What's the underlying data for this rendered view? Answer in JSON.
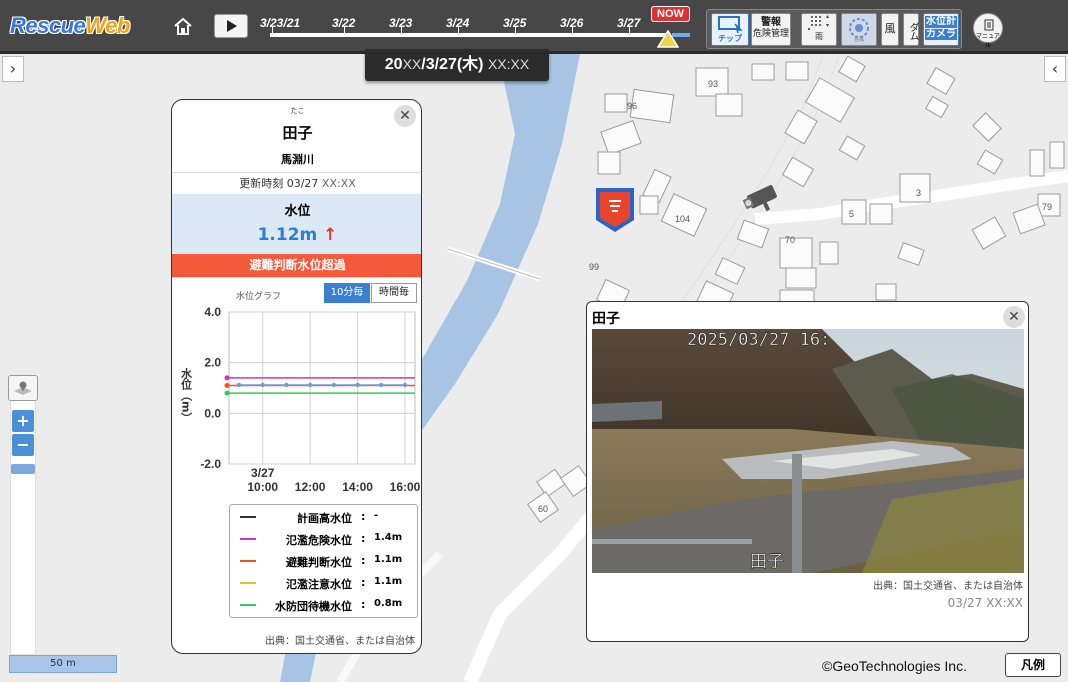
{
  "app": {
    "logo_a": "Rescue",
    "logo_b": "Web"
  },
  "timeline": {
    "dates": [
      "3/23/21",
      "3/22",
      "3/23",
      "3/24",
      "3/25",
      "3/26",
      "3/27"
    ],
    "now_label": "NOW"
  },
  "toolbar": {
    "chip_label": "チップ",
    "warning_line1": "警報",
    "warning_line2": "危険管理",
    "rain_label": "雨",
    "typhoon_label": "台風",
    "wind_label": "風",
    "dam_label": "ダム",
    "gauge_line1": "水位計",
    "gauge_line2": "カメラ",
    "manual_label": "マニュアル"
  },
  "timebar": {
    "bold": "20",
    "dim1": "XX",
    "bold2": "/3/27(木)",
    "dim2": "XX:XX"
  },
  "map": {
    "labels": [
      "93",
      "96",
      "104",
      "99",
      "70",
      "5",
      "3",
      "79",
      "60"
    ],
    "copyright": "©GeoTechnologies Inc.",
    "scale": "50 m",
    "legend_button": "凡例"
  },
  "info": {
    "ruby": "たこ",
    "name": "田子",
    "river": "馬淵川",
    "updated_label": "更新時刻",
    "updated_date": "03/27",
    "updated_time": "XX:XX",
    "level_title": "水位",
    "level_value": "1.12m",
    "level_trend": "↑",
    "alert": "避難判断水位超過",
    "graph_label": "水位グラフ",
    "seg_10min": "10分毎",
    "seg_hourly": "時間毎",
    "legend": [
      {
        "name": "計画高水位",
        "value": "-",
        "color": "#333333"
      },
      {
        "name": "氾濫危険水位",
        "value": "1.4m",
        "color": "#cc33cc"
      },
      {
        "name": "避難判断水位",
        "value": "1.1m",
        "color": "#ee5522"
      },
      {
        "name": "氾濫注意水位",
        "value": "1.1m",
        "color": "#cccc22"
      },
      {
        "name": "水防団待機水位",
        "value": "0.8m",
        "color": "#33cc55"
      }
    ],
    "source": "出典：国土交通省、または自治体"
  },
  "chart_data": {
    "type": "line",
    "ylabel": "水位（m）",
    "yticks": [
      "4.0",
      "2.0",
      "0.0",
      "-2.0"
    ],
    "ylim": [
      -2.0,
      4.0
    ],
    "date_label": "3/27",
    "xticks": [
      "10:00",
      "12:00",
      "14:00",
      "16:00"
    ],
    "x": [
      "09:00",
      "10:00",
      "11:00",
      "12:00",
      "13:00",
      "14:00",
      "15:00",
      "16:00"
    ],
    "series": [
      {
        "name": "水位",
        "color": "#6b9ed6",
        "values": [
          1.12,
          1.12,
          1.12,
          1.12,
          1.12,
          1.12,
          1.12,
          1.12
        ]
      }
    ],
    "thresholds": [
      {
        "name": "氾濫危険水位",
        "value": 1.4,
        "color": "#cc33cc"
      },
      {
        "name": "避難判断水位",
        "value": 1.1,
        "color": "#ee5522"
      },
      {
        "name": "水防団待機水位",
        "value": 0.8,
        "color": "#33cc55"
      }
    ]
  },
  "camera": {
    "title": "田子",
    "overlay_time": "2025/03/27 16:",
    "overlay_name": "田子",
    "source": "出典：国土交通省、または自治体",
    "time": "03/27 XX:XX"
  }
}
